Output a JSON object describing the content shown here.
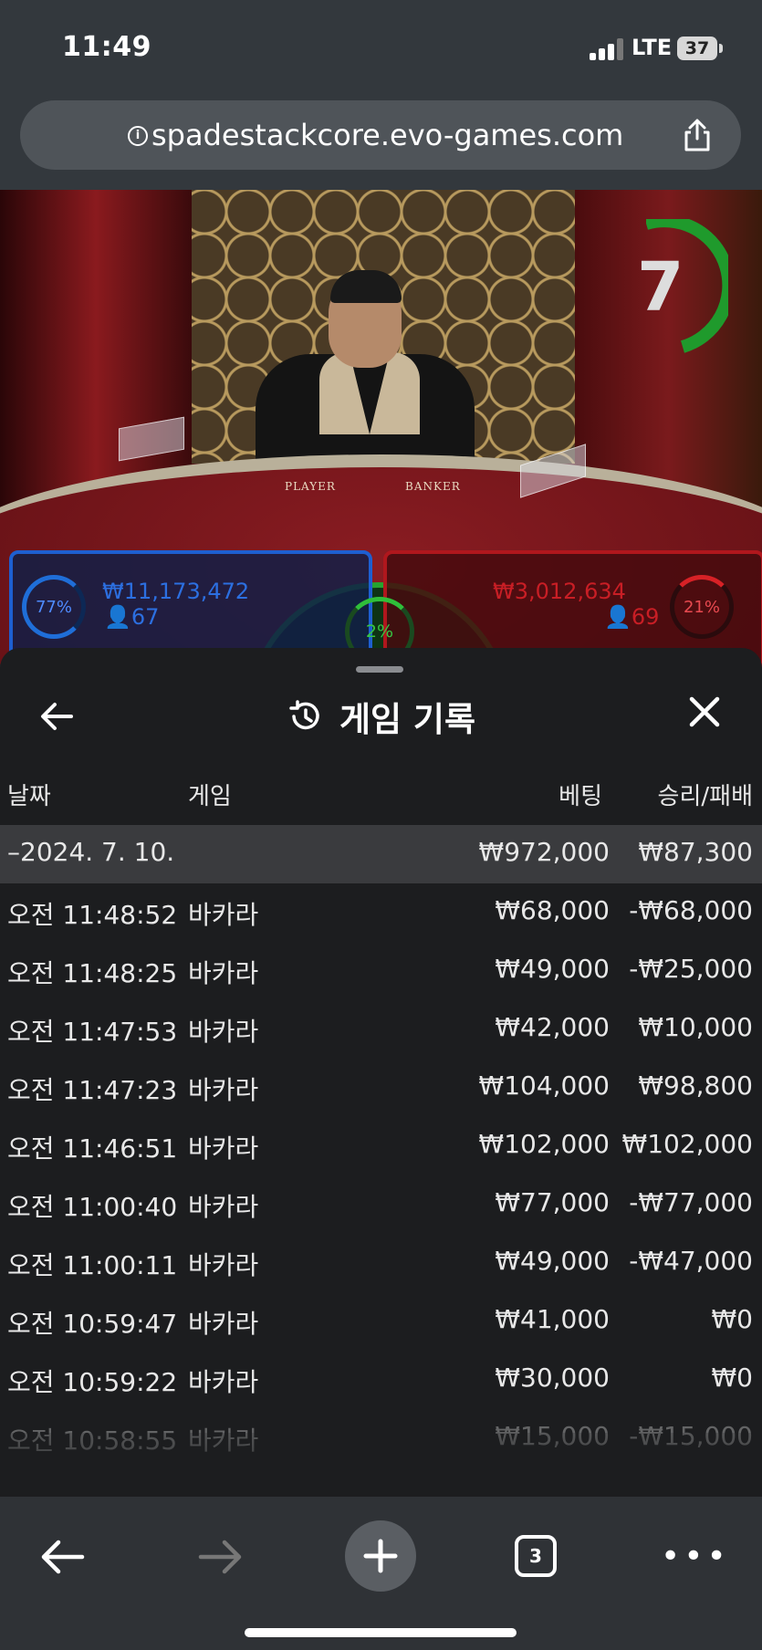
{
  "status_bar": {
    "time": "11:49",
    "network": "LTE",
    "battery": "37"
  },
  "browser": {
    "url": "spadestackcore.evo-games.com"
  },
  "live": {
    "countdown": "7",
    "table_labels": {
      "player": "PLAYER",
      "banker": "BANKER"
    },
    "player": {
      "percent": "77%",
      "amount": "₩11,173,472",
      "players": "67"
    },
    "banker": {
      "percent": "21%",
      "amount": "₩3,012,634",
      "players": "69"
    },
    "tie": {
      "percent": "2%"
    }
  },
  "history": {
    "title": "게임 기록",
    "columns": {
      "date": "날짜",
      "game": "게임",
      "bet": "베팅",
      "result": "승리/패배"
    },
    "date_row": {
      "date": "–2024. 7. 10.",
      "bet": "₩972,000",
      "result": "₩87,300"
    },
    "rows": [
      {
        "time": "오전 11:48:52",
        "game": "바카라",
        "bet": "₩68,000",
        "result": "-₩68,000"
      },
      {
        "time": "오전 11:48:25",
        "game": "바카라",
        "bet": "₩49,000",
        "result": "-₩25,000"
      },
      {
        "time": "오전 11:47:53",
        "game": "바카라",
        "bet": "₩42,000",
        "result": "₩10,000"
      },
      {
        "time": "오전 11:47:23",
        "game": "바카라",
        "bet": "₩104,000",
        "result": "₩98,800"
      },
      {
        "time": "오전 11:46:51",
        "game": "바카라",
        "bet": "₩102,000",
        "result": "₩102,000"
      },
      {
        "time": "오전 11:00:40",
        "game": "바카라",
        "bet": "₩77,000",
        "result": "-₩77,000"
      },
      {
        "time": "오전 11:00:11",
        "game": "바카라",
        "bet": "₩49,000",
        "result": "-₩47,000"
      },
      {
        "time": "오전 10:59:47",
        "game": "바카라",
        "bet": "₩41,000",
        "result": "₩0"
      },
      {
        "time": "오전 10:59:22",
        "game": "바카라",
        "bet": "₩30,000",
        "result": "₩0"
      },
      {
        "time": "오전 10:58:55",
        "game": "바카라",
        "bet": "₩15,000",
        "result": "-₩15,000"
      }
    ]
  },
  "toolbar": {
    "tab_count": "3"
  },
  "colors": {
    "player_blue": "#2c6fe0",
    "banker_red": "#c81e25",
    "tie_green": "#26a32f"
  }
}
